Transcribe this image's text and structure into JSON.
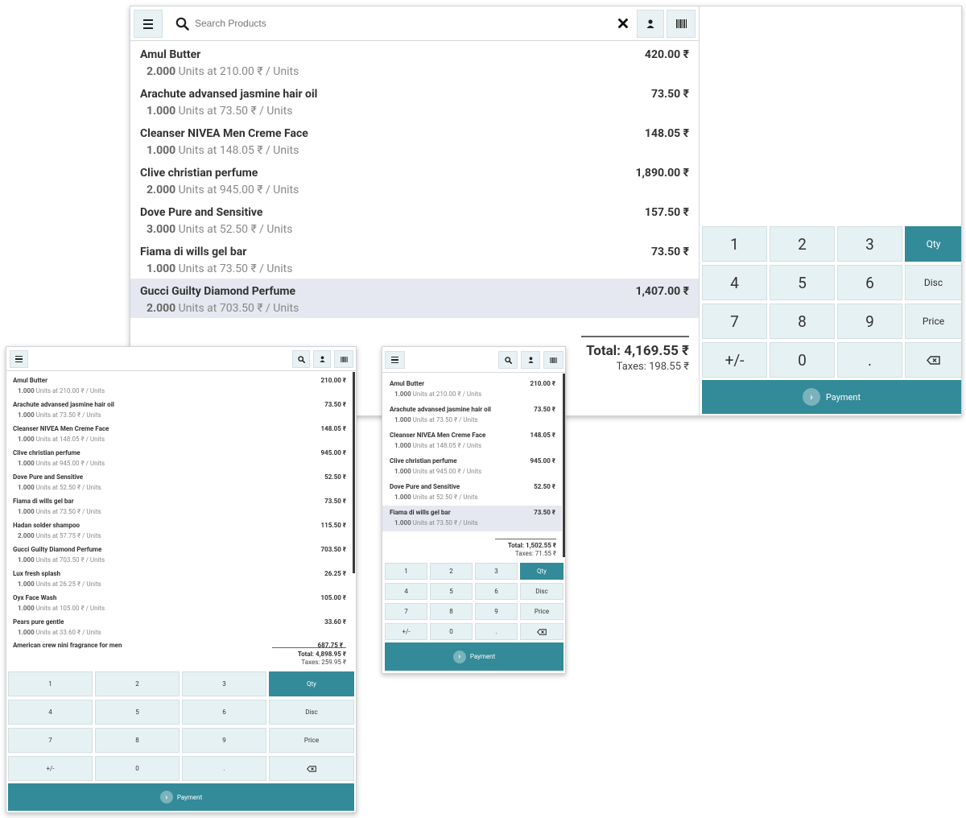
{
  "colors": {
    "accent": "#338a98",
    "key_bg": "#e6f1f3",
    "selected_row": "#e5e8f0"
  },
  "large": {
    "search_placeholder": "Search Products",
    "lines": [
      {
        "name": "Amul Butter",
        "qty": "2.000",
        "info": " Units at 210.00 ₹ / Units",
        "price": "420.00 ₹"
      },
      {
        "name": "Arachute advansed jasmine hair oil",
        "qty": "1.000",
        "info": " Units at 73.50 ₹ / Units",
        "price": "73.50 ₹"
      },
      {
        "name": "Cleanser NIVEA Men Creme Face",
        "qty": "1.000",
        "info": " Units at 148.05 ₹ / Units",
        "price": "148.05 ₹"
      },
      {
        "name": "Clive christian perfume",
        "qty": "2.000",
        "info": " Units at 945.00 ₹ / Units",
        "price": "1,890.00 ₹"
      },
      {
        "name": "Dove Pure and Sensitive",
        "qty": "3.000",
        "info": " Units at 52.50 ₹ / Units",
        "price": "157.50 ₹"
      },
      {
        "name": "Fiama di wills gel bar",
        "qty": "1.000",
        "info": " Units at 73.50 ₹ / Units",
        "price": "73.50 ₹"
      },
      {
        "name": "Gucci Guilty Diamond Perfume",
        "qty": "2.000",
        "info": " Units at 703.50 ₹ / Units",
        "price": "1,407.00 ₹"
      }
    ],
    "total": "Total: 4,169.55 ₹",
    "taxes": "Taxes: 198.55 ₹",
    "payment": "Payment"
  },
  "left": {
    "lines": [
      {
        "name": "Amul Butter",
        "qty": "1.000",
        "info": " Units at 210.00 ₹ / Units",
        "price": "210.00 ₹"
      },
      {
        "name": "Arachute advansed jasmine hair oil",
        "qty": "1.000",
        "info": " Units at 73.50 ₹ / Units",
        "price": "73.50 ₹"
      },
      {
        "name": "Cleanser NIVEA Men Creme Face",
        "qty": "1.000",
        "info": " Units at 148.05 ₹ / Units",
        "price": "148.05 ₹"
      },
      {
        "name": "Clive christian perfume",
        "qty": "1.000",
        "info": " Units at 945.00 ₹ / Units",
        "price": "945.00 ₹"
      },
      {
        "name": "Dove Pure and Sensitive",
        "qty": "1.000",
        "info": " Units at 52.50 ₹ / Units",
        "price": "52.50 ₹"
      },
      {
        "name": "Fiama di wills gel bar",
        "qty": "1.000",
        "info": " Units at 73.50 ₹ / Units",
        "price": "73.50 ₹"
      },
      {
        "name": "Hadan solder shampoo",
        "qty": "2.000",
        "info": " Units at 57.75 ₹ / Units",
        "price": "115.50 ₹"
      },
      {
        "name": "Gucci Guilty Diamond Perfume",
        "qty": "1.000",
        "info": " Units at 703.50 ₹ / Units",
        "price": "703.50 ₹"
      },
      {
        "name": "Lux fresh splash",
        "qty": "1.000",
        "info": " Units at 26.25 ₹ / Units",
        "price": "26.25 ₹"
      },
      {
        "name": "Oyx Face Wash",
        "qty": "1.000",
        "info": " Units at 105.00 ₹ / Units",
        "price": "105.00 ₹"
      },
      {
        "name": "Pears pure gentle",
        "qty": "1.000",
        "info": " Units at 33.60 ₹ / Units",
        "price": "33.60 ₹"
      },
      {
        "name": "American crew nini fragrance for men",
        "qty": "",
        "info": "",
        "price": "687.75 ₹"
      }
    ],
    "total": "Total: 4,898.95 ₹",
    "taxes": "Taxes: 259.95 ₹",
    "payment": "Payment"
  },
  "mid": {
    "lines": [
      {
        "name": "Amul Butter",
        "qty": "1.000",
        "info": " Units at 210.00 ₹ / Units",
        "price": "210.00 ₹"
      },
      {
        "name": "Arachute advansed jasmine hair oil",
        "qty": "1.000",
        "info": " Units at 73.50 ₹ / Units",
        "price": "73.50 ₹"
      },
      {
        "name": "Cleanser NIVEA Men Creme Face",
        "qty": "1.000",
        "info": " Units at 148.05 ₹ / Units",
        "price": "148.05 ₹"
      },
      {
        "name": "Clive christian perfume",
        "qty": "1.000",
        "info": " Units at 945.00 ₹ / Units",
        "price": "945.00 ₹"
      },
      {
        "name": "Dove Pure and Sensitive",
        "qty": "1.000",
        "info": " Units at 52.50 ₹ / Units",
        "price": "52.50 ₹"
      },
      {
        "name": "Fiama di wills gel bar",
        "qty": "1.000",
        "info": " Units at 73.50 ₹ / Units",
        "price": "73.50 ₹"
      }
    ],
    "total": "Total: 1,502.55 ₹",
    "taxes": "Taxes: 71.55 ₹",
    "payment": "Payment"
  },
  "keypad": {
    "k1": "1",
    "k2": "2",
    "k3": "3",
    "qty": "Qty",
    "k4": "4",
    "k5": "5",
    "k6": "6",
    "disc": "Disc",
    "k7": "7",
    "k8": "8",
    "k9": "9",
    "price": "Price",
    "sign": "+/-",
    "k0": "0",
    "dot": "."
  }
}
